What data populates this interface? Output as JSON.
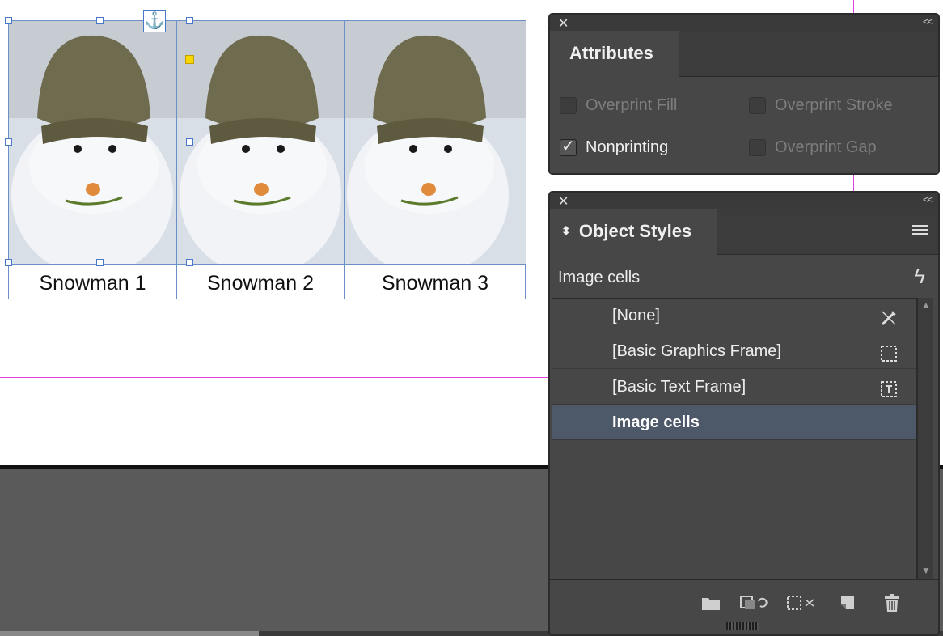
{
  "document": {
    "captions": [
      "Snowman 1",
      "Snowman 2",
      "Snowman 3"
    ],
    "anchor_icon": "anchor-icon"
  },
  "attributes_panel": {
    "tab_label": "Attributes",
    "close_icon": "close-icon",
    "collapse_label": "<<",
    "options": [
      {
        "label": "Overprint Fill",
        "checked": false
      },
      {
        "label": "Overprint Stroke",
        "checked": false
      },
      {
        "label": "Nonprinting",
        "checked": true
      },
      {
        "label": "Overprint Gap",
        "checked": false
      }
    ]
  },
  "object_styles_panel": {
    "tab_label": "Object Styles",
    "close_icon": "close-icon",
    "collapse_label": "<<",
    "current_style": "Image cells",
    "styles": [
      {
        "label": "[None]",
        "icon": "pencil-strikethrough-icon",
        "selected": false
      },
      {
        "label": "[Basic Graphics Frame]",
        "icon": "graphics-frame-icon",
        "selected": false
      },
      {
        "label": "[Basic Text Frame]",
        "icon": "text-frame-icon",
        "selected": false
      },
      {
        "label": "Image cells",
        "icon": "",
        "selected": true
      }
    ],
    "footer_icons": [
      "folder-icon",
      "clear-overrides-icon",
      "clear-attributes-icon",
      "new-style-icon",
      "trash-icon"
    ]
  },
  "colors": {
    "panel_bg": "#474747",
    "selection": "#4d5868",
    "frame_blue": "#6c8fc8",
    "guide_magenta": "#e040e0"
  }
}
